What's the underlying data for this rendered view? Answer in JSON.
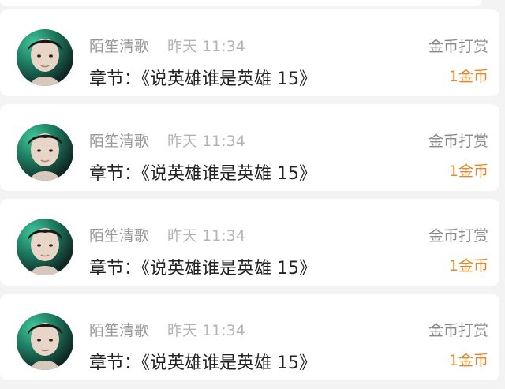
{
  "items": [
    {
      "username": "陌笙清歌",
      "time": "昨天 11:34",
      "chapter": "章节：《说英雄谁是英雄 15》",
      "reward_label": "金币打赏",
      "reward_amount": "1金币"
    },
    {
      "username": "陌笙清歌",
      "time": "昨天 11:34",
      "chapter": "章节：《说英雄谁是英雄 15》",
      "reward_label": "金币打赏",
      "reward_amount": "1金币"
    },
    {
      "username": "陌笙清歌",
      "time": "昨天 11:34",
      "chapter": "章节：《说英雄谁是英雄 15》",
      "reward_label": "金币打赏",
      "reward_amount": "1金币"
    },
    {
      "username": "陌笙清歌",
      "time": "昨天 11:34",
      "chapter": "章节：《说英雄谁是英雄 15》",
      "reward_label": "金币打赏",
      "reward_amount": "1金币"
    }
  ],
  "colors": {
    "background": "#f3f3f3",
    "card": "#ffffff",
    "username": "#9a9a9a",
    "chapter": "#222222",
    "reward_amount": "#e28a2c"
  }
}
